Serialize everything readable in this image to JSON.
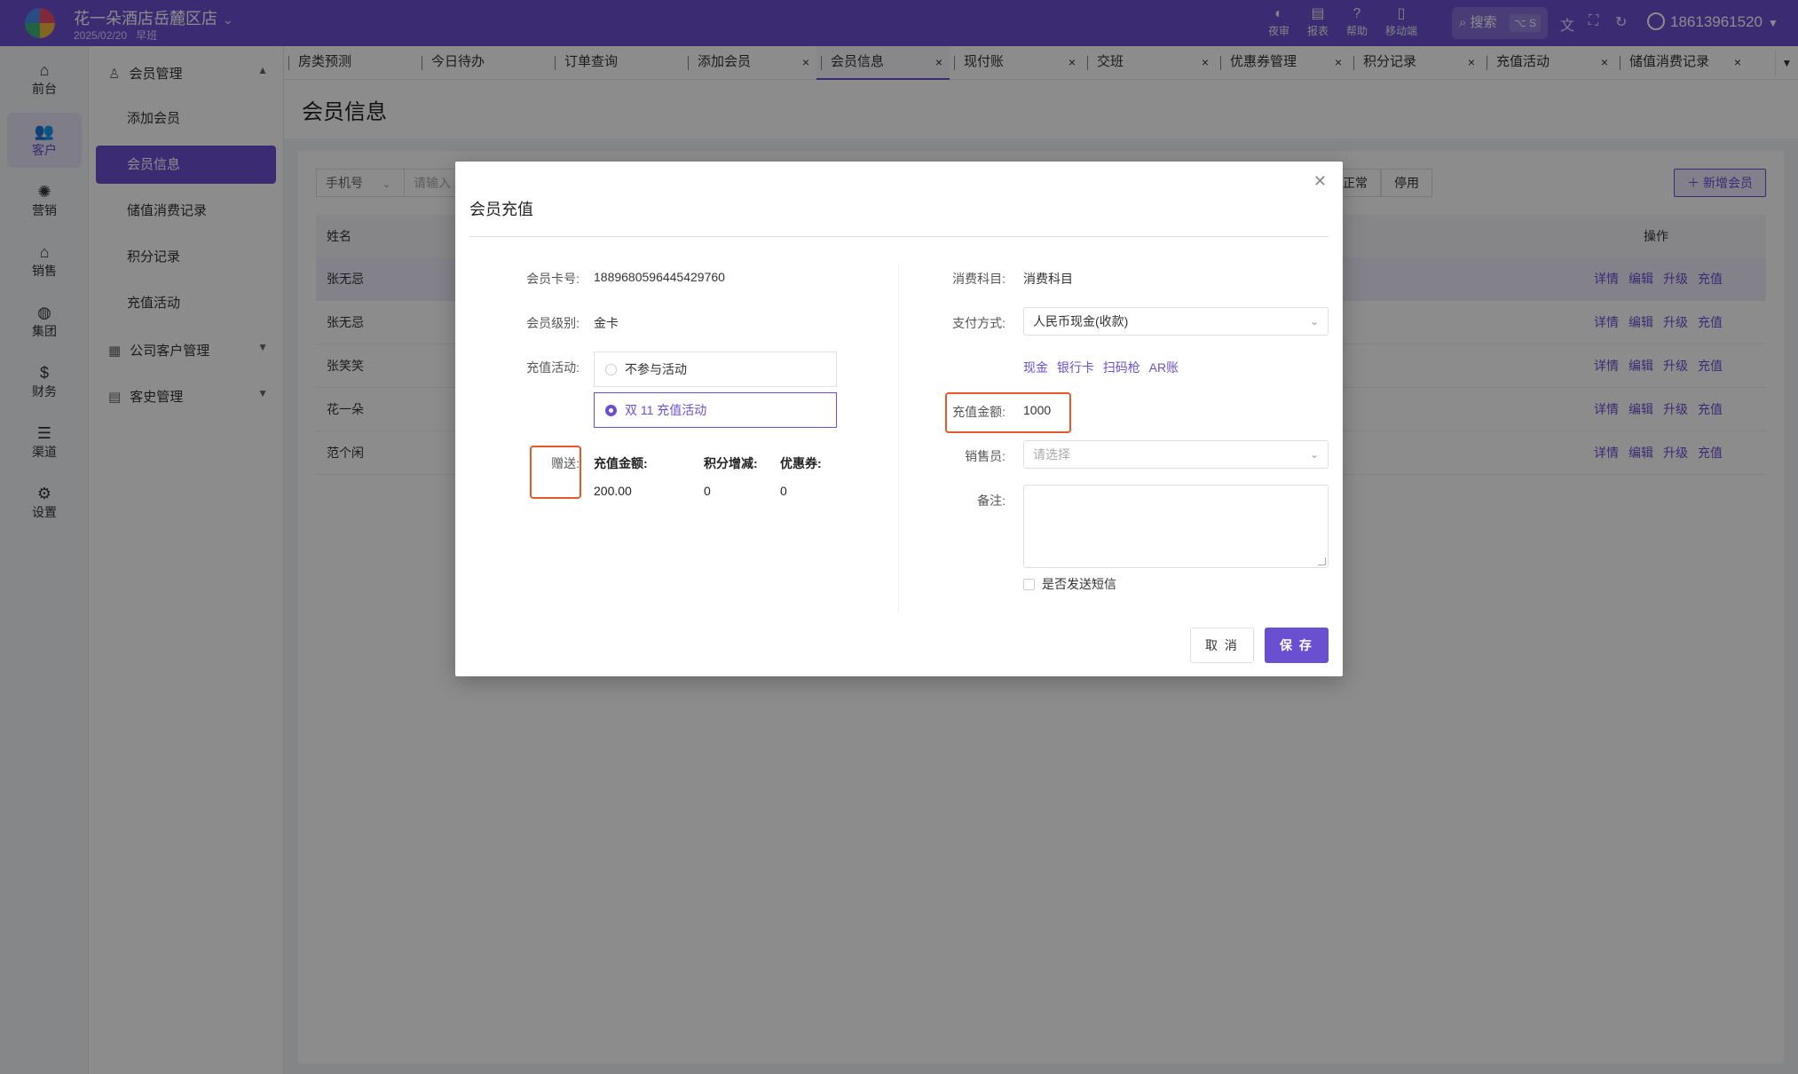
{
  "header": {
    "shop_name": "花一朵酒店岳麓区店",
    "date": "2025/02/20",
    "shift": "早班",
    "tools": [
      {
        "label": "夜审",
        "icon": "moon-icon"
      },
      {
        "label": "报表",
        "icon": "report-icon"
      },
      {
        "label": "帮助",
        "icon": "help-icon"
      },
      {
        "label": "移动端",
        "icon": "mobile-icon"
      }
    ],
    "search_label": "搜索",
    "search_shortcut": "⌥ S",
    "user": "18613961520"
  },
  "rail": {
    "items": [
      {
        "label": "前台",
        "icon": "frontdesk-icon"
      },
      {
        "label": "客户",
        "icon": "customer-icon"
      },
      {
        "label": "营销",
        "icon": "marketing-icon"
      },
      {
        "label": "销售",
        "icon": "sales-icon"
      },
      {
        "label": "集团",
        "icon": "group-icon"
      },
      {
        "label": "财务",
        "icon": "finance-icon"
      },
      {
        "label": "渠道",
        "icon": "channel-icon"
      },
      {
        "label": "设置",
        "icon": "settings-icon"
      }
    ],
    "active": "客户"
  },
  "subnav": {
    "group1": "会员管理",
    "items": [
      "添加会员",
      "会员信息",
      "储值消费记录",
      "积分记录",
      "充值活动"
    ],
    "group2": "公司客户管理",
    "group3": "客史管理"
  },
  "tabs": [
    "房类预测",
    "今日待办",
    "订单查询",
    "添加会员",
    "会员信息",
    "现付账",
    "交班",
    "优惠券管理",
    "积分记录",
    "充值活动",
    "储值消费记录"
  ],
  "page": {
    "title": "会员信息",
    "filter_select": "手机号",
    "filter_placeholder": "请输入",
    "status_normal": "正常",
    "status_disabled": "停用",
    "add_button": "新增会员",
    "col_name": "姓名",
    "col_ops": "操作",
    "rows": [
      "张无忌",
      "张无忌",
      "张笑笑",
      "花一朵",
      "范个闲"
    ],
    "ops": [
      "详情",
      "编辑",
      "升级",
      "充值"
    ]
  },
  "modal": {
    "title": "会员充值",
    "card_no_label": "会员卡号:",
    "card_no": "1889680596445429760",
    "level_label": "会员级别:",
    "level": "金卡",
    "activity_label": "充值活动:",
    "activity_options": [
      "不参与活动",
      "双 11 充值活动"
    ],
    "activity_selected": "双 11 充值活动",
    "gift_label": "赠送:",
    "gift_headers": [
      "充值金额:",
      "积分增减:",
      "优惠券:"
    ],
    "gift_values": [
      "200.00",
      "0",
      "0"
    ],
    "subject_label": "消费科目:",
    "subject": "消费科目",
    "pay_label": "支付方式:",
    "pay_method": "人民币现金(收款)",
    "pay_links": [
      "现金",
      "银行卡",
      "扫码枪",
      "AR账"
    ],
    "amount_label": "充值金额:",
    "amount": "1000",
    "seller_label": "销售员:",
    "seller_placeholder": "请选择",
    "remark_label": "备注:",
    "sms_label": "是否发送短信",
    "cancel": "取 消",
    "save": "保 存"
  },
  "colors": {
    "brand": "#6b4fd1",
    "highlight": "#e8572a"
  }
}
